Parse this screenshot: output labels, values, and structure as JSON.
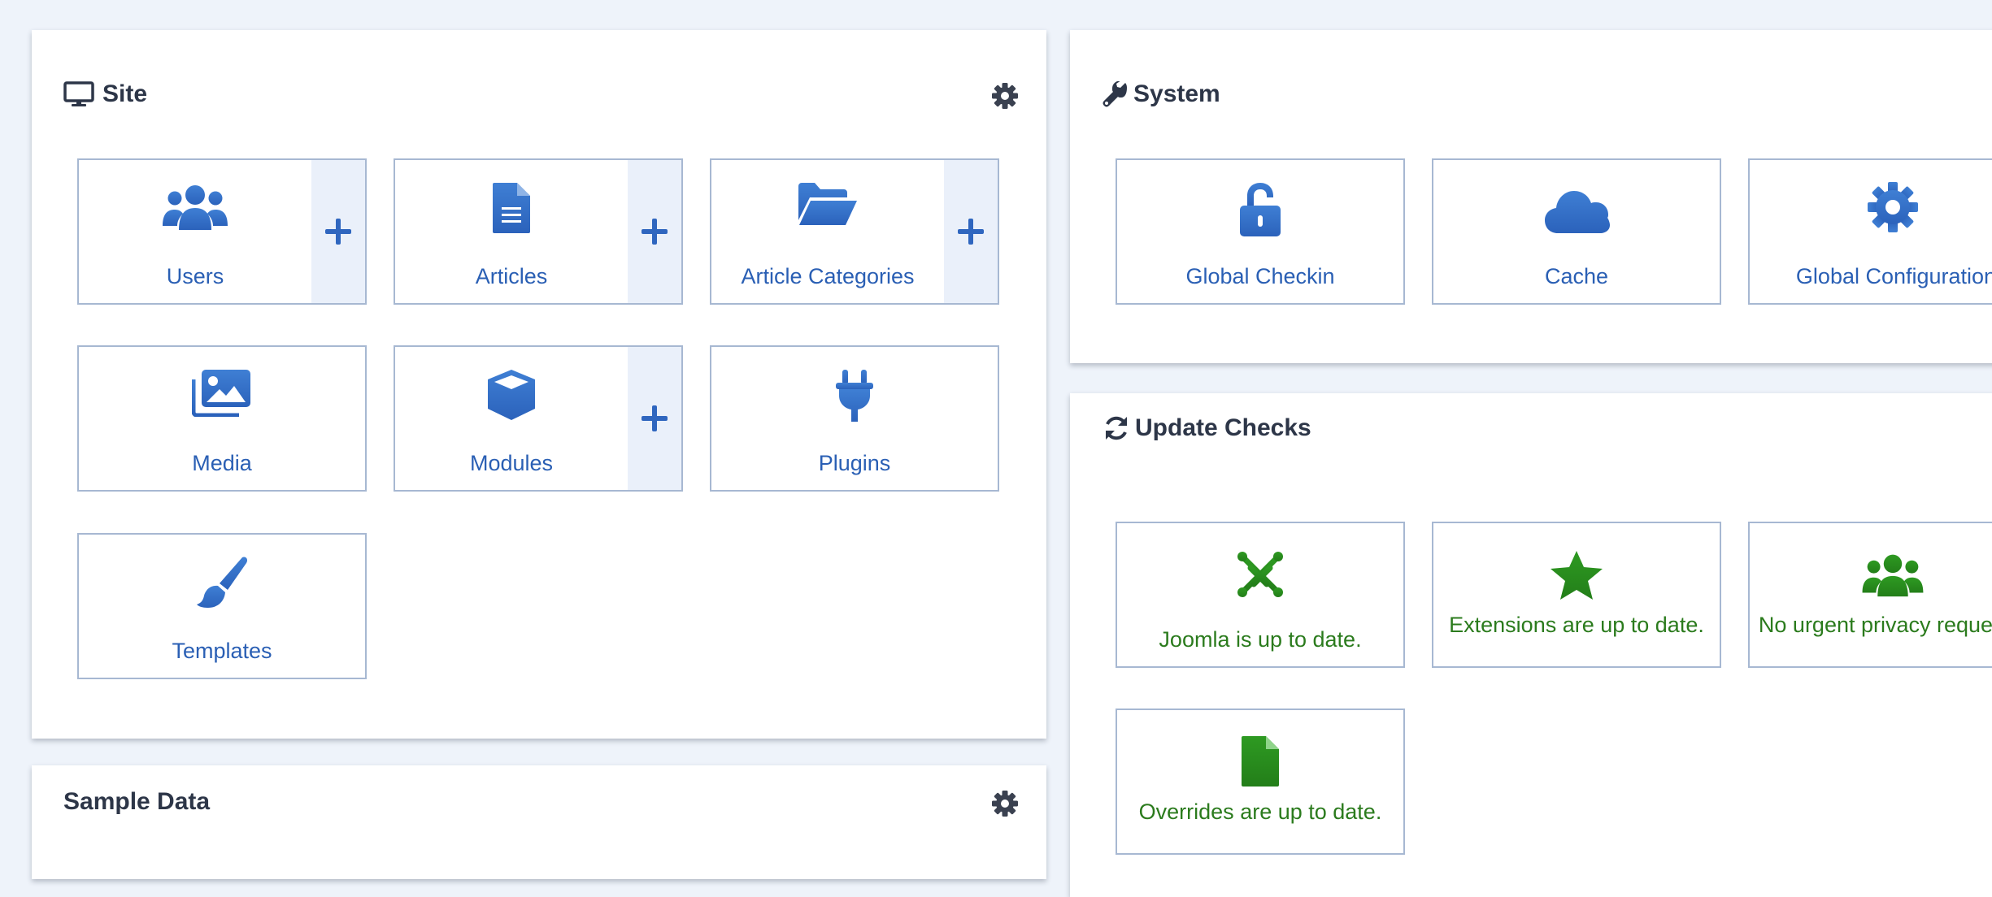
{
  "colors": {
    "background": "#eef3fa",
    "tile_blue": "#2a5fb4",
    "status_green": "#2b7b1d",
    "heading": "#2d3648"
  },
  "site": {
    "title": "Site",
    "icon": "desktop-icon",
    "tiles": [
      {
        "label": "Users",
        "icon": "users-icon",
        "has_add": true
      },
      {
        "label": "Articles",
        "icon": "file-alt-icon",
        "has_add": true
      },
      {
        "label": "Article Categories",
        "icon": "folder-open-icon",
        "has_add": true
      },
      {
        "label": "Media",
        "icon": "images-icon",
        "has_add": false
      },
      {
        "label": "Modules",
        "icon": "cube-icon",
        "has_add": true
      },
      {
        "label": "Plugins",
        "icon": "plug-icon",
        "has_add": false
      },
      {
        "label": "Templates",
        "icon": "paint-brush-icon",
        "has_add": false
      }
    ]
  },
  "sample_data": {
    "title": "Sample Data"
  },
  "system": {
    "title": "System",
    "icon": "wrench-icon",
    "tiles": [
      {
        "label": "Global Checkin",
        "icon": "unlock-icon"
      },
      {
        "label": "Cache",
        "icon": "cloud-icon"
      },
      {
        "label": "Global Configuration",
        "icon": "cog-icon"
      }
    ]
  },
  "update_checks": {
    "title": "Update Checks",
    "icon": "sync-icon",
    "tiles": [
      {
        "label": "Joomla is up to date.",
        "icon": "joomla-icon"
      },
      {
        "label": "Extensions are up to date.",
        "icon": "star-icon"
      },
      {
        "label": "No urgent privacy requests.",
        "icon": "users-icon"
      },
      {
        "label": "Overrides are up to date.",
        "icon": "file-icon"
      }
    ]
  }
}
